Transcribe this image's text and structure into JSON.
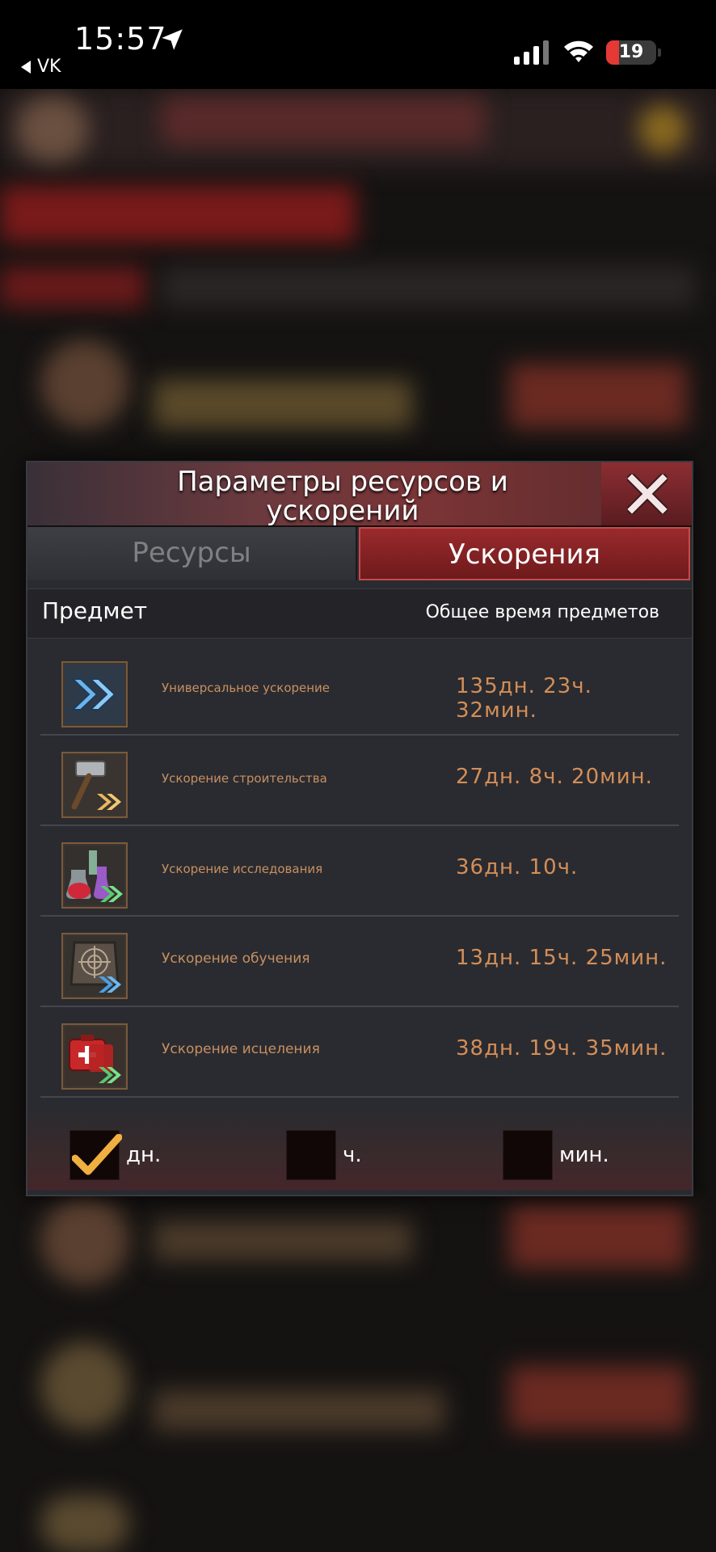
{
  "status_bar": {
    "time": "15:57",
    "back_app": "VK",
    "battery": "19"
  },
  "dialog": {
    "title": "Параметры ресурсов и ускорений",
    "tabs": [
      {
        "label": "Ресурсы",
        "active": false
      },
      {
        "label": "Ускорения",
        "active": true
      }
    ],
    "columns": {
      "item": "Предмет",
      "total_time": "Общее время предметов"
    },
    "rows": [
      {
        "name": "Универсальное ускорение",
        "time": "135дн. 23ч. 32мин.",
        "icon": "universal-speedup-icon"
      },
      {
        "name": "Ускорение строительства",
        "time": "27дн. 8ч. 20мин.",
        "icon": "hammer-speedup-icon"
      },
      {
        "name": "Ускорение исследования",
        "time": "36дн. 10ч.",
        "icon": "flask-speedup-icon"
      },
      {
        "name": "Ускорение обучения",
        "time": "13дн. 15ч. 25мин.",
        "icon": "target-speedup-icon"
      },
      {
        "name": "Ускорение исцеления",
        "time": "38дн. 19ч. 35мин.",
        "icon": "medkit-speedup-icon"
      }
    ],
    "units": [
      {
        "label": "дн.",
        "checked": true
      },
      {
        "label": "ч.",
        "checked": false
      },
      {
        "label": "мин.",
        "checked": false
      }
    ]
  },
  "colors": {
    "accent_red": "#9a2a2c",
    "time_text": "#d38e58",
    "item_name": "#c79062",
    "check": "#f0b040"
  }
}
